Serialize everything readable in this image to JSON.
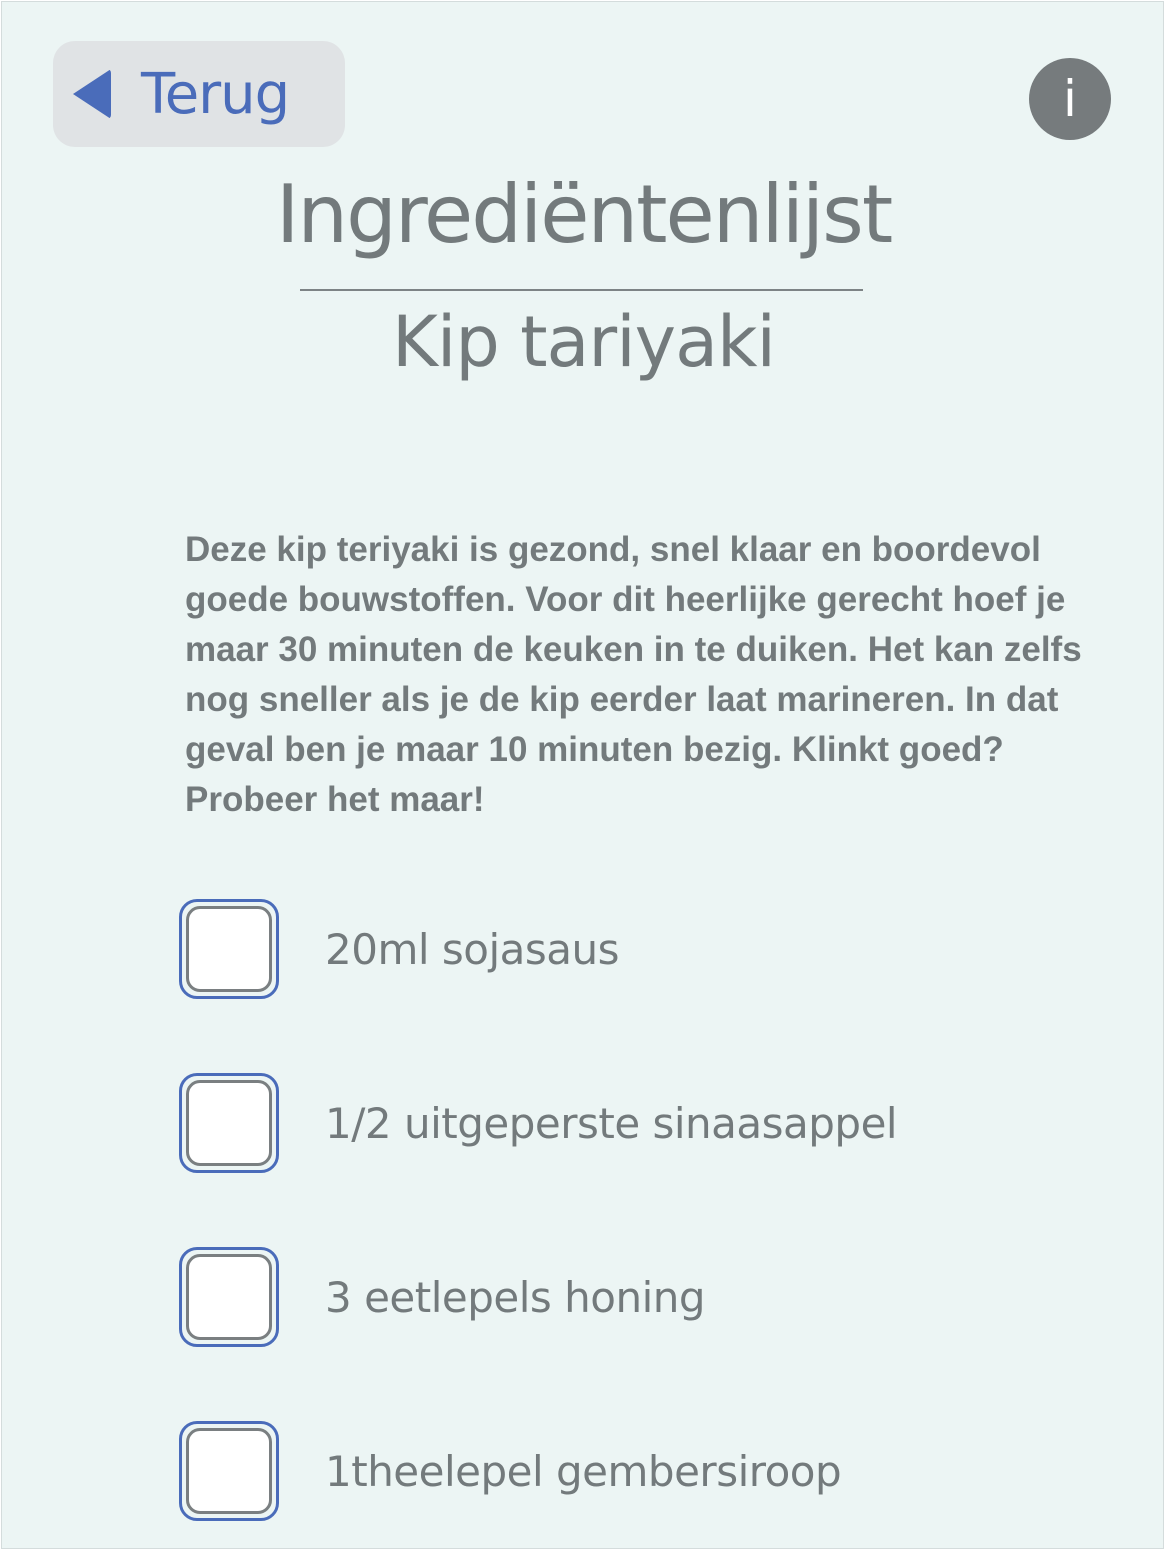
{
  "header": {
    "back_label": "Terug",
    "back_icon": "triangle-left-icon",
    "info_icon_glyph": "i",
    "accent_color": "#4a6cba"
  },
  "title": "Ingrediëntenlijst",
  "recipe": {
    "name": "Kip tariyaki",
    "description": "Deze kip teriyaki is gezond, snel klaar en boordevol goede bouwstoffen. Voor dit heerlijke gerecht hoef je maar 30 minuten de keuken in te duiken. Het kan zelfs nog sneller als je de kip eerder laat marineren. In dat geval ben je maar 10 minuten bezig. Klinkt goed? Probeer het maar!"
  },
  "ingredients": [
    {
      "label": "20ml sojasaus",
      "checked": false
    },
    {
      "label": "1/2 uitgeperste sinaasappel",
      "checked": false
    },
    {
      "label": "3 eetlepels honing",
      "checked": false
    },
    {
      "label": "1theelepel gembersiroop",
      "checked": false
    }
  ]
}
